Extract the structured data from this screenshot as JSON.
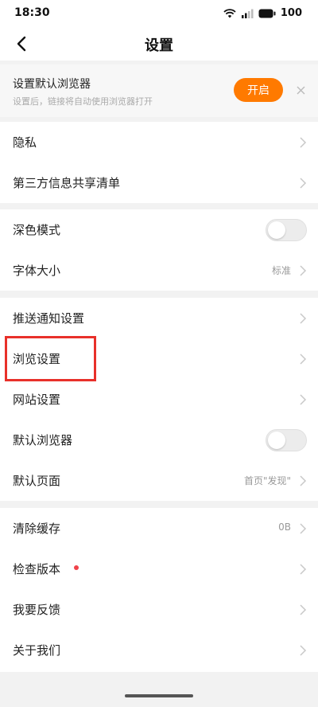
{
  "status_bar": {
    "time": "18:30",
    "battery": "100"
  },
  "nav": {
    "title": "设置"
  },
  "banner": {
    "title": "设置默认浏览器",
    "subtitle": "设置后，链接将自动使用浏览器打开",
    "button": "开启"
  },
  "group1": [
    {
      "label": "隐私"
    },
    {
      "label": "第三方信息共享清单"
    }
  ],
  "group2": [
    {
      "label": "深色模式",
      "toggle_on": false
    },
    {
      "label": "字体大小",
      "value": "标准"
    }
  ],
  "group3": [
    {
      "label": "推送通知设置"
    },
    {
      "label": "浏览设置"
    },
    {
      "label": "网站设置"
    },
    {
      "label": "默认浏览器",
      "toggle_on": false
    },
    {
      "label": "默认页面",
      "value": "首页\"发现\""
    }
  ],
  "group4": [
    {
      "label": "清除缓存",
      "value": "0B"
    },
    {
      "label": "检查版本",
      "has_dot": true
    },
    {
      "label": "我要反馈"
    },
    {
      "label": "关于我们"
    }
  ],
  "colors": {
    "accent": "#ff7a00",
    "highlight": "#e8302a",
    "dot": "#f0424a"
  }
}
